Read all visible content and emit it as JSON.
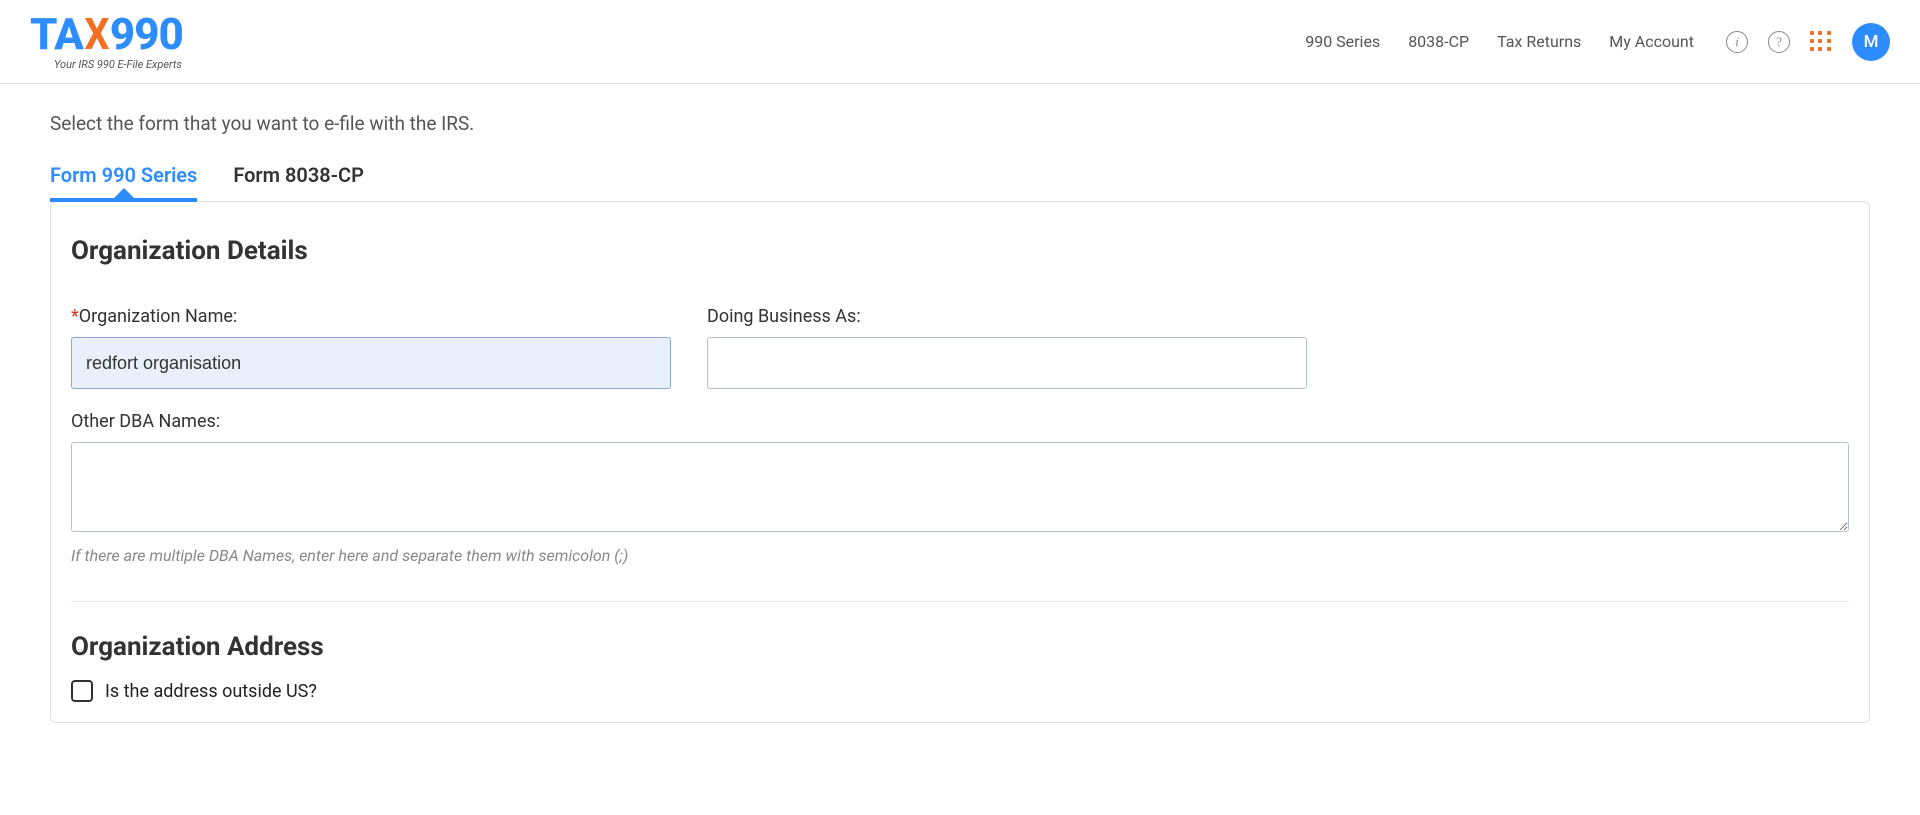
{
  "header": {
    "logo_part1": "TA",
    "logo_x": "X",
    "logo_part2": "990",
    "tagline": "Your IRS 990 E-File Experts",
    "nav": {
      "series": "990 Series",
      "cp": "8038-CP",
      "returns": "Tax Returns",
      "account": "My Account"
    },
    "avatar_initial": "M"
  },
  "page": {
    "instruction": "Select the form that you want to e-file with the IRS."
  },
  "tabs": {
    "tab1": "Form 990 Series",
    "tab2": "Form 8038-CP"
  },
  "org_details": {
    "section_title": "Organization Details",
    "org_name_label": "Organization Name:",
    "org_name_value": "redfort organisation",
    "dba_label": "Doing Business As:",
    "dba_value": "",
    "other_dba_label": "Other DBA Names:",
    "other_dba_value": "",
    "other_dba_hint": "If there are multiple DBA Names, enter here and separate them with semicolon (;)"
  },
  "org_address": {
    "section_title": "Organization Address",
    "outside_us_label": "Is the address outside US?",
    "outside_us_checked": false
  }
}
